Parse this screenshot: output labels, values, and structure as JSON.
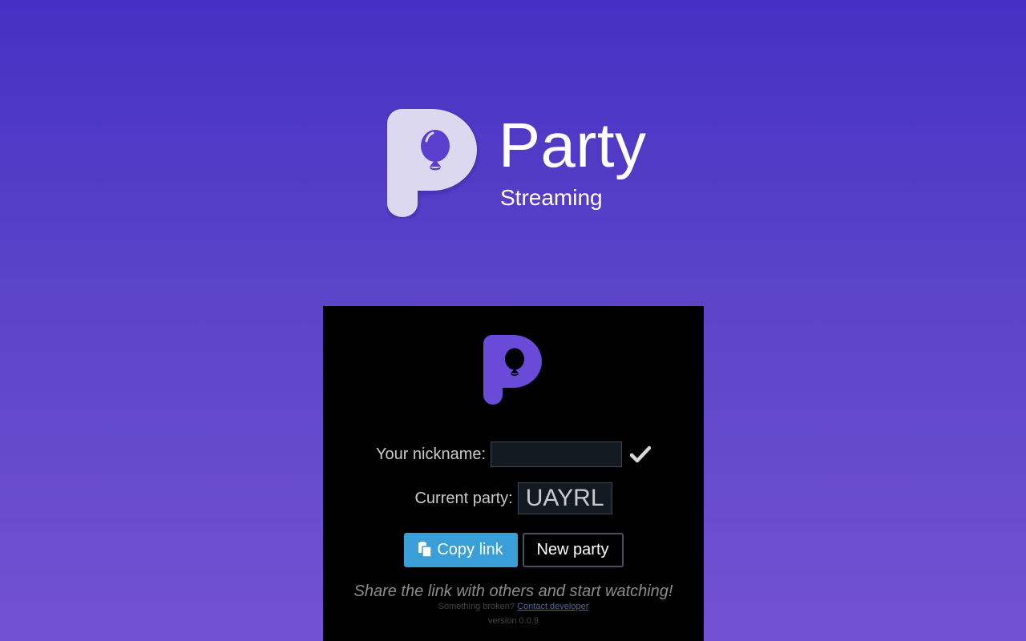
{
  "hero": {
    "logo_icon": "party-balloon-logo-icon",
    "title": "Party",
    "subtitle": "Streaming"
  },
  "popup": {
    "logo_icon": "party-balloon-logo-icon",
    "nickname": {
      "label": "Your nickname:",
      "value": "",
      "placeholder": "",
      "confirm_icon": "check-icon"
    },
    "party": {
      "label": "Current party:",
      "code": "UAYRL"
    },
    "buttons": {
      "copy_label": "Copy link",
      "copy_icon": "clipboard-copy-icon",
      "new_label": "New party"
    },
    "tagline": "Share the link with others and start watching!",
    "footer": {
      "prefix": "Something broken?",
      "link": "Contact developer",
      "version": "version 0.0.9"
    }
  },
  "colors": {
    "background_top": "#4630c4",
    "background_bottom": "#7352d2",
    "hero_logo": "#dcd8f0",
    "popup_logo": "#6a4ad8",
    "copy_button": "#3a9fd6"
  }
}
